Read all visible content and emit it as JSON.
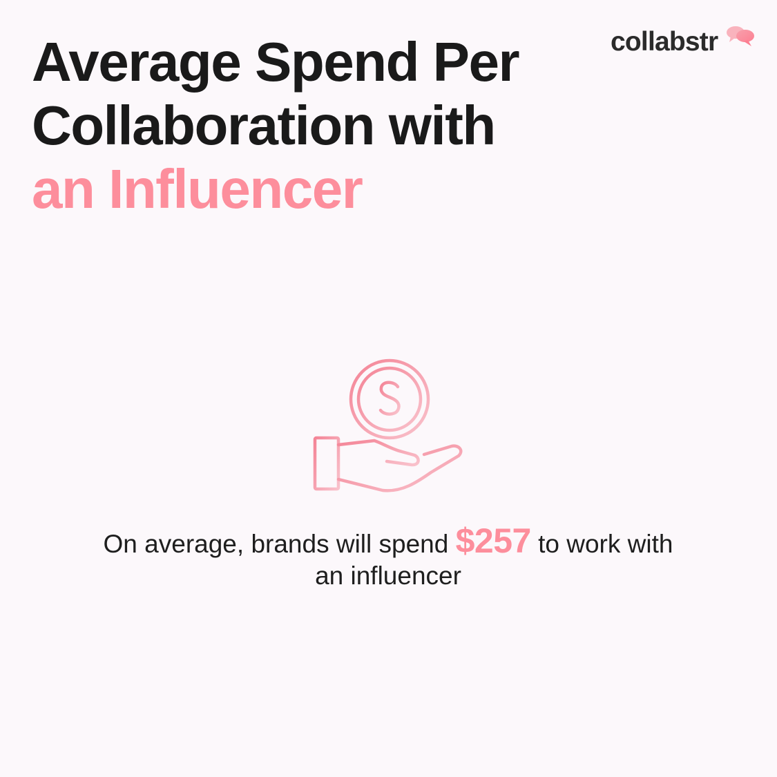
{
  "headline": {
    "line1": "Average Spend Per",
    "line2": "Collaboration with",
    "line3": "an Influencer"
  },
  "brand": {
    "name": "collabstr",
    "icon": "speech-bubbles-icon"
  },
  "illustration": {
    "icon": "hand-holding-coin-icon"
  },
  "caption": {
    "before": "On average, brands will spend",
    "amount": "$257",
    "after": "to work with",
    "line2": "an influencer"
  },
  "colors": {
    "accent": "#fd8e9c",
    "text": "#1a1a1a",
    "background": "#fcf8fb"
  }
}
